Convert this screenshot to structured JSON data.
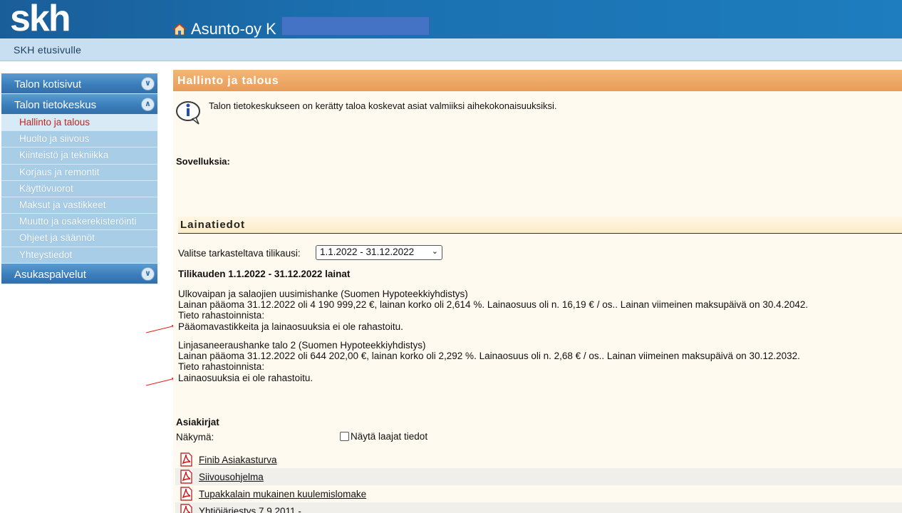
{
  "header": {
    "logo_text": "skh",
    "site_title": "Asunto-oy K",
    "home_link": "SKH etusivulle"
  },
  "sidebar": {
    "groups": [
      {
        "label": "Talon kotisivut",
        "icon": "chevron-double-down-icon"
      },
      {
        "label": "Talon tietokeskus",
        "icon": "chevron-double-up-icon"
      },
      {
        "label": "Asukaspalvelut",
        "icon": "chevron-double-down-icon"
      }
    ],
    "items": [
      {
        "label": "Hallinto ja talous",
        "active": true
      },
      {
        "label": "Huolto ja siivous"
      },
      {
        "label": "Kiinteistö ja tekniikka"
      },
      {
        "label": "Korjaus ja remontit"
      },
      {
        "label": "Käyttövuorot"
      },
      {
        "label": "Maksut ja vastikkeet"
      },
      {
        "label": "Muutto ja osakerekisteröinti"
      },
      {
        "label": "Ohjeet ja säännöt"
      },
      {
        "label": "Yhteystiedot"
      }
    ]
  },
  "main": {
    "section_title": "Hallinto ja talous",
    "info_text": "Talon tietokeskukseen on kerätty taloa koskevat asiat valmiiksi aihekokonaisuuksiksi.",
    "apps_label": "Sovelluksia:",
    "loans": {
      "heading": "Lainatiedot",
      "period_label": "Valitse tarkasteltava tilikausi:",
      "period_selected": "1.1.2022 - 31.12.2022",
      "period_title": "Tilikauden 1.1.2022 - 31.12.2022 lainat",
      "items": [
        {
          "name": "Ulkovaipan ja salaojien uusimishanke (Suomen Hypoteekkiyhdistys)",
          "details": "Lainan pääoma 31.12.2022 oli 4 190 999,22 €, lainan korko oli 2,614 %. Lainaosuus oli n. 16,19 € / os.. Lainan viimeinen maksupäivä on 30.4.2042.",
          "fund_label": "Tieto rahastoinnista:",
          "fund_text": "Pääomavastikkeita ja lainaosuuksia ei ole rahastoitu."
        },
        {
          "name": "Linjasaneeraushanke talo 2 (Suomen Hypoteekkiyhdistys)",
          "details": "Lainan pääoma 31.12.2022 oli 644 202,00 €, lainan korko oli 2,292 %. Lainaosuus oli n. 2,68 € / os.. Lainan viimeinen maksupäivä on 30.12.2032.",
          "fund_label": "Tieto rahastoinnista:",
          "fund_text": "Lainaosuuksia ei ole rahastoitu."
        }
      ]
    },
    "documents": {
      "heading": "Asiakirjat",
      "view_label": "Näkymä:",
      "wide_label": "Näytä laajat tiedot",
      "wide_checked": false,
      "items": [
        "Finib Asiakasturva",
        "Siivousohjelma",
        "Tupakkalain mukainen kuulemislomake",
        "Yhtiöjärjestys 7.9.2011 -"
      ]
    }
  },
  "colors": {
    "header_blue": "#1b70b0",
    "nav_bar": "#c8dff1",
    "section_orange": "#e99c58",
    "active_red": "#c8231c",
    "content_bg": "#fffaf0",
    "annotation_arrow": "#e02020"
  }
}
